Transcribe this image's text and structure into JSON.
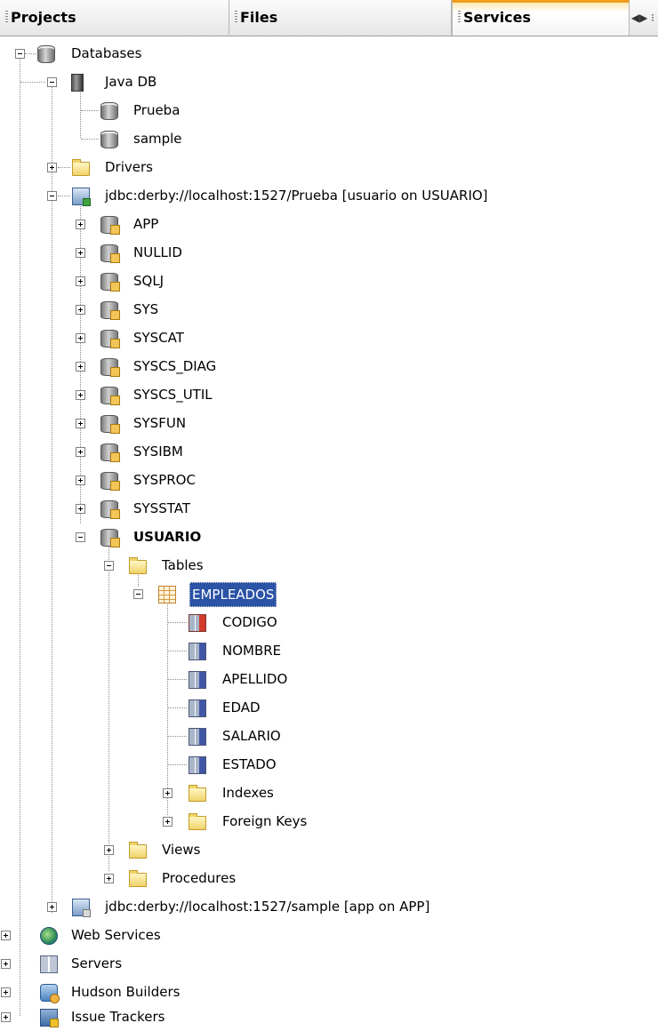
{
  "tabs": [
    {
      "label": "Projects",
      "active": false
    },
    {
      "label": "Files",
      "active": false
    },
    {
      "label": "Services",
      "active": true
    }
  ],
  "tab_tools": {
    "label": "◀▶ ⁝"
  },
  "tree": {
    "databases": "Databases",
    "java_db": "Java DB",
    "prueba": "Prueba",
    "sample": "sample",
    "drivers": "Drivers",
    "conn_prueba": "jdbc:derby://localhost:1527/Prueba [usuario on USUARIO]",
    "schemas": [
      "APP",
      "NULLID",
      "SQLJ",
      "SYS",
      "SYSCAT",
      "SYSCS_DIAG",
      "SYSCS_UTIL",
      "SYSFUN",
      "SYSIBM",
      "SYSPROC",
      "SYSSTAT"
    ],
    "usuario": "USUARIO",
    "tables": "Tables",
    "empleados": "EMPLEADOS",
    "columns": [
      "CODIGO",
      "NOMBRE",
      "APELLIDO",
      "EDAD",
      "SALARIO",
      "ESTADO"
    ],
    "indexes": "Indexes",
    "foreign_keys": "Foreign Keys",
    "views": "Views",
    "procedures": "Procedures",
    "conn_sample": "jdbc:derby://localhost:1527/sample [app on APP]",
    "web_services": "Web Services",
    "servers": "Servers",
    "hudson": "Hudson Builders",
    "issue_trackers": "Issue Trackers"
  },
  "colors": {
    "selection": "#2b53a6",
    "active_tab_accent": "#f29d1f"
  }
}
